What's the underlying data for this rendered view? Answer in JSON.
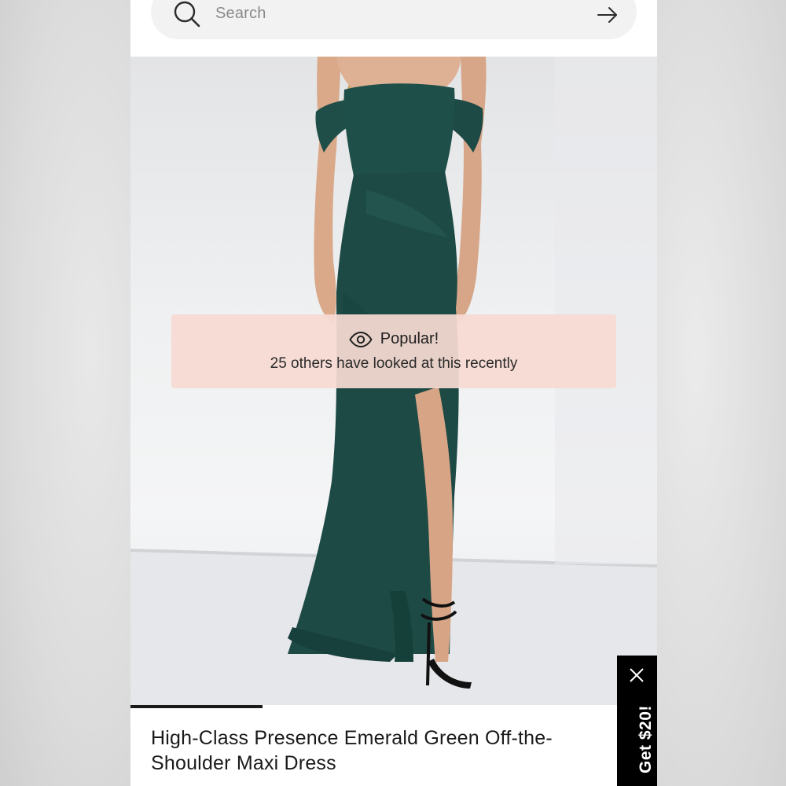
{
  "search": {
    "placeholder": "Search"
  },
  "toast": {
    "title": "Popular!",
    "message": "25 others have looked at this recently",
    "icon": "eye-icon"
  },
  "product": {
    "title": "High-Class Presence Emerald Green Off-the-Shoulder Maxi Dress",
    "dress_color": "#1d4a45"
  },
  "carousel": {
    "progress": 0.25
  },
  "promo": {
    "label": "Get $20!",
    "close_icon": "close-icon"
  },
  "colors": {
    "toast_bg": "#f6dad2",
    "promo_bg": "#000000",
    "text": "#1a1a1a"
  }
}
